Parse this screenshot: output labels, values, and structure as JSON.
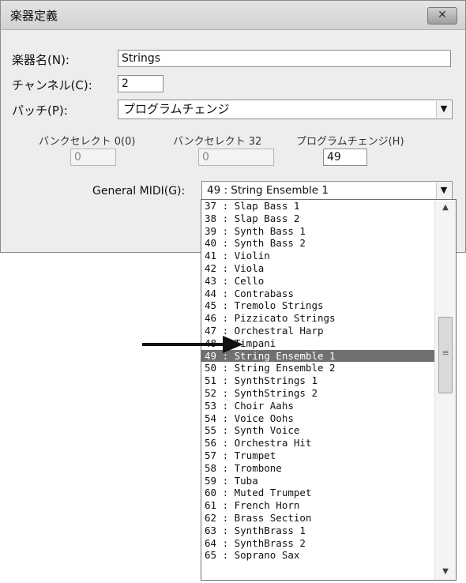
{
  "window": {
    "title": "楽器定義",
    "close_label": "✕"
  },
  "form": {
    "instrument_label": "楽器名(N):",
    "instrument_value": "Strings",
    "channel_label": "チャンネル(C):",
    "channel_value": "2",
    "patch_label": "パッチ(P):",
    "patch_value": "プログラムチェンジ",
    "bank0_label": "バンクセレクト 0(0)",
    "bank0_value": "0",
    "bank32_label": "バンクセレクト 32",
    "bank32_value": "0",
    "program_label": "プログラムチェンジ(H)",
    "program_value": "49",
    "gm_label": "General MIDI(G):",
    "gm_value": "49 : String Ensemble 1"
  },
  "dropdown": {
    "selected_index": 12,
    "items": [
      "37 : Slap Bass 1",
      "38 : Slap Bass 2",
      "39 : Synth Bass 1",
      "40 : Synth Bass 2",
      "41 : Violin",
      "42 : Viola",
      "43 : Cello",
      "44 : Contrabass",
      "45 : Tremolo Strings",
      "46 : Pizzicato Strings",
      "47 : Orchestral Harp",
      "48 : Timpani",
      "49 : String Ensemble 1",
      "50 : String Ensemble 2",
      "51 : SynthStrings 1",
      "52 : SynthStrings 2",
      "53 : Choir Aahs",
      "54 : Voice Oohs",
      "55 : Synth Voice",
      "56 : Orchestra Hit",
      "57 : Trumpet",
      "58 : Trombone",
      "59 : Tuba",
      "60 : Muted Trumpet",
      "61 : French Horn",
      "62 : Brass Section",
      "63 : SynthBrass 1",
      "64 : SynthBrass 2",
      "65 : Soprano Sax"
    ]
  },
  "icons": {
    "dropdown_arrow": "▼",
    "scroll_up": "▲",
    "scroll_down": "▼",
    "thumb_grip": "≡"
  }
}
